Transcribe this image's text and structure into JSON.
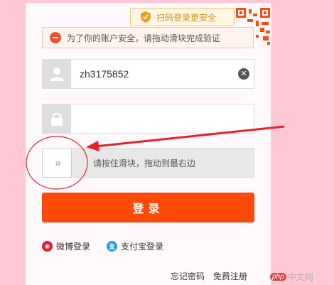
{
  "header": {
    "qr_login_label": "扫码登录更安全"
  },
  "notice": {
    "text": "为了你的账户安全，请拖动滑块完成验证"
  },
  "username": {
    "value": "zh3175852"
  },
  "password": {
    "value": ""
  },
  "slider": {
    "knob_glyph": "»",
    "hint": "请按住滑块，拖动到最右边",
    "progress": 0
  },
  "login_button": {
    "label": "登录"
  },
  "social": {
    "weibo_label": "微博登录",
    "alipay_label": "支付宝登录"
  },
  "footer": {
    "forgot_password": "忘记密码",
    "register": "免费注册"
  },
  "watermark": {
    "badge": "php",
    "text": "中文网"
  },
  "colors": {
    "background": "#ffc8d4",
    "accent": "#ff4a0a",
    "annotation": "#e8202a"
  },
  "icons": {
    "qr_badge": "shield-icon",
    "username": "user-icon",
    "password": "lock-icon",
    "clear": "close-icon"
  }
}
